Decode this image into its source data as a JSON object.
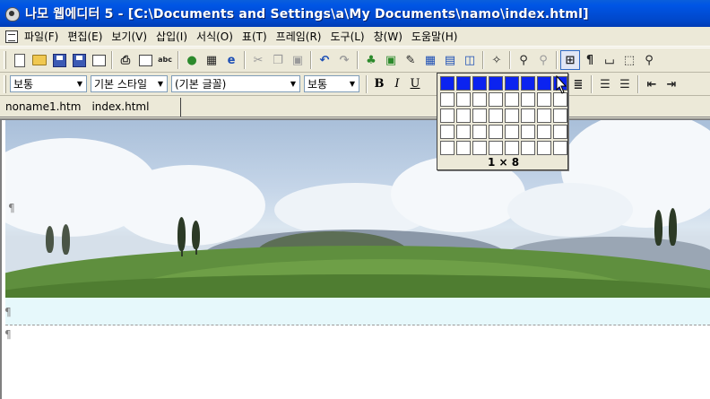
{
  "window": {
    "title": "나모 웹에디터 5 - [C:\\Documents and Settings\\a\\My Documents\\namo\\index.html]"
  },
  "menu": {
    "items": [
      {
        "label": "파일(F)"
      },
      {
        "label": "편집(E)"
      },
      {
        "label": "보기(V)"
      },
      {
        "label": "삽입(I)"
      },
      {
        "label": "서식(O)"
      },
      {
        "label": "표(T)"
      },
      {
        "label": "프레임(R)"
      },
      {
        "label": "도구(L)"
      },
      {
        "label": "창(W)"
      },
      {
        "label": "도움말(H)"
      }
    ]
  },
  "toolbar": {
    "icons": [
      "new-page-icon",
      "open-folder-icon",
      "save-icon",
      "save-all-icon",
      "template-icon",
      "print-icon",
      "preview-icon",
      "spellcheck-icon",
      "browser-preview-icon",
      "publish-icon",
      "internet-explorer-icon",
      "cut-icon",
      "copy-icon",
      "paste-icon",
      "undo-icon",
      "redo-icon",
      "tree-image-icon",
      "image-icon",
      "edit-image-icon",
      "insert-table-icon",
      "insert-frame-icon",
      "layout-icon",
      "magic-wand-icon",
      "link-icon",
      "unlink-icon",
      "table-grid-icon",
      "paragraph-mark-icon",
      "space-mark-icon",
      "layer-box-icon",
      "zoom-icon"
    ],
    "spellcheck_text": "abc"
  },
  "format": {
    "paragraph": "보통",
    "style": "기본 스타일",
    "font": "(기본 글꼴)",
    "size": "보통",
    "bold": "B",
    "italic": "I",
    "underline": "U"
  },
  "tabs": [
    {
      "label": "noname1.htm",
      "active": false
    },
    {
      "label": "index.html",
      "active": true
    }
  ],
  "table_picker": {
    "rows": 5,
    "cols": 8,
    "selected_rows": 1,
    "selected_cols": 8,
    "label": "1 × 8"
  },
  "editor": {
    "paragraph_mark": "¶"
  },
  "colors": {
    "title_bar": "#0055e5",
    "selected_cell": "#0b23f0",
    "cyan_row": "#e6f8fb"
  }
}
